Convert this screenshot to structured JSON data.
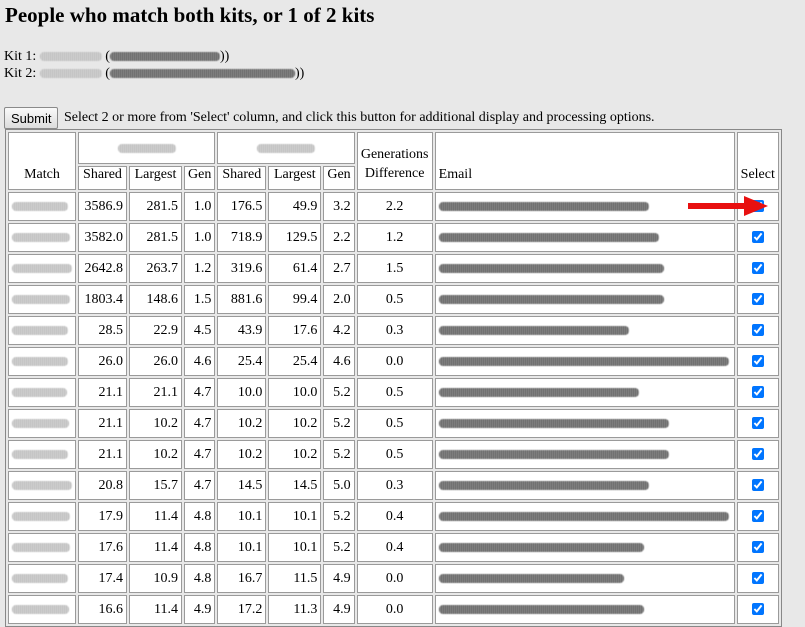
{
  "page": {
    "title": "People who match both kits, or 1 of 2 kits"
  },
  "kits": [
    {
      "label": "Kit 1:",
      "paren_open": "(",
      "paren_close": "))"
    },
    {
      "label": "Kit 2:",
      "paren_open": "(",
      "paren_close": "))"
    }
  ],
  "toolbar": {
    "submit_label": "Submit",
    "instructions": "Select 2 or more from 'Select' column, and click this button for additional display and processing options."
  },
  "table": {
    "headers": {
      "match": "Match",
      "kit1_shared": "Shared",
      "kit1_largest": "Largest",
      "kit1_gen": "Gen",
      "kit2_shared": "Shared",
      "kit2_largest": "Largest",
      "kit2_gen": "Gen",
      "gen_diff": "Generations Difference",
      "email": "Email",
      "select": "Select"
    },
    "rows": [
      {
        "s1": "3586.9",
        "l1": "281.5",
        "g1": "1.0",
        "s2": "176.5",
        "l2": "49.9",
        "g2": "3.2",
        "gd": "2.2",
        "selected": true
      },
      {
        "s1": "3582.0",
        "l1": "281.5",
        "g1": "1.0",
        "s2": "718.9",
        "l2": "129.5",
        "g2": "2.2",
        "gd": "1.2",
        "selected": true
      },
      {
        "s1": "2642.8",
        "l1": "263.7",
        "g1": "1.2",
        "s2": "319.6",
        "l2": "61.4",
        "g2": "2.7",
        "gd": "1.5",
        "selected": true
      },
      {
        "s1": "1803.4",
        "l1": "148.6",
        "g1": "1.5",
        "s2": "881.6",
        "l2": "99.4",
        "g2": "2.0",
        "gd": "0.5",
        "selected": true
      },
      {
        "s1": "28.5",
        "l1": "22.9",
        "g1": "4.5",
        "s2": "43.9",
        "l2": "17.6",
        "g2": "4.2",
        "gd": "0.3",
        "selected": true
      },
      {
        "s1": "26.0",
        "l1": "26.0",
        "g1": "4.6",
        "s2": "25.4",
        "l2": "25.4",
        "g2": "4.6",
        "gd": "0.0",
        "selected": true
      },
      {
        "s1": "21.1",
        "l1": "21.1",
        "g1": "4.7",
        "s2": "10.0",
        "l2": "10.0",
        "g2": "5.2",
        "gd": "0.5",
        "selected": true
      },
      {
        "s1": "21.1",
        "l1": "10.2",
        "g1": "4.7",
        "s2": "10.2",
        "l2": "10.2",
        "g2": "5.2",
        "gd": "0.5",
        "selected": true
      },
      {
        "s1": "21.1",
        "l1": "10.2",
        "g1": "4.7",
        "s2": "10.2",
        "l2": "10.2",
        "g2": "5.2",
        "gd": "0.5",
        "selected": true
      },
      {
        "s1": "20.8",
        "l1": "15.7",
        "g1": "4.7",
        "s2": "14.5",
        "l2": "14.5",
        "g2": "5.0",
        "gd": "0.3",
        "selected": true
      },
      {
        "s1": "17.9",
        "l1": "11.4",
        "g1": "4.8",
        "s2": "10.1",
        "l2": "10.1",
        "g2": "5.2",
        "gd": "0.4",
        "selected": true
      },
      {
        "s1": "17.6",
        "l1": "11.4",
        "g1": "4.8",
        "s2": "10.1",
        "l2": "10.1",
        "g2": "5.2",
        "gd": "0.4",
        "selected": true
      },
      {
        "s1": "17.4",
        "l1": "10.9",
        "g1": "4.8",
        "s2": "16.7",
        "l2": "11.5",
        "g2": "4.9",
        "gd": "0.0",
        "selected": true
      },
      {
        "s1": "16.6",
        "l1": "11.4",
        "g1": "4.9",
        "s2": "17.2",
        "l2": "11.3",
        "g2": "4.9",
        "gd": "0.0",
        "selected": true
      }
    ]
  },
  "colors": {
    "background": "#e8e8e8",
    "arrow": "#e81010"
  },
  "icons": {
    "pointer": "arrow-right-icon"
  }
}
